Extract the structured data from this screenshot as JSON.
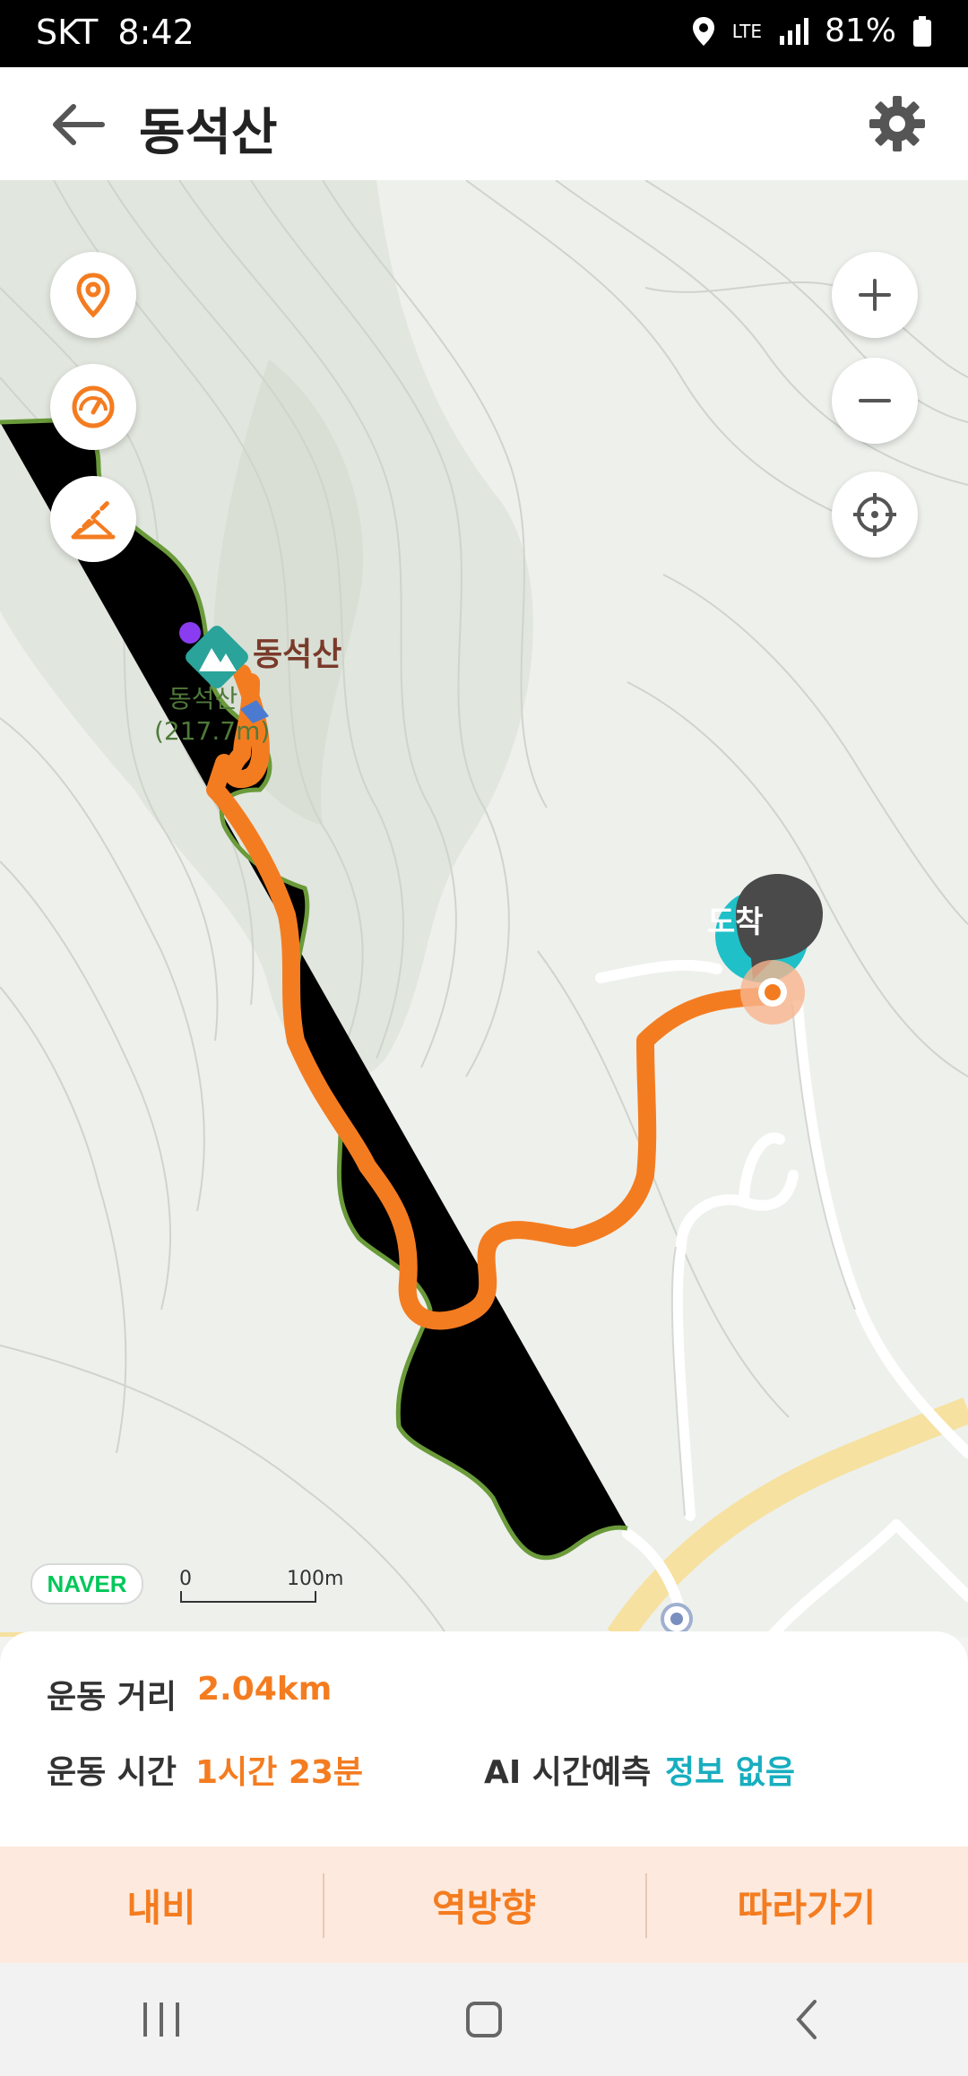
{
  "status_bar": {
    "carrier": "SKT",
    "time": "8:42",
    "network": "LTE",
    "battery": "81%"
  },
  "header": {
    "title": "동석산",
    "back_icon": "arrow-left-icon",
    "settings_icon": "gear-icon"
  },
  "map": {
    "peak_label": "동석산",
    "peak_sub_label_1": "동석산",
    "peak_sub_label_2": "(217.7m)",
    "arrival_label": "도착",
    "provider": "NAVER",
    "scale": {
      "start": "0",
      "end": "100m"
    },
    "controls": [
      "location-pin-icon",
      "speedometer-icon",
      "elevation-icon",
      "zoom-in-icon",
      "zoom-out-icon",
      "crosshair-icon"
    ],
    "colors": {
      "route": "#f47c20",
      "trail": "#6a9a3a",
      "road": "#f6e1a0"
    }
  },
  "stats": {
    "distance_label": "운동 거리",
    "distance_value": "2.04km",
    "time_label": "운동 시간",
    "time_value": "1시간 23분",
    "ai_label": "AI 시간예측",
    "ai_value": "정보 없음"
  },
  "actions": {
    "navigate": "내비",
    "reverse": "역방향",
    "follow": "따라가기"
  }
}
